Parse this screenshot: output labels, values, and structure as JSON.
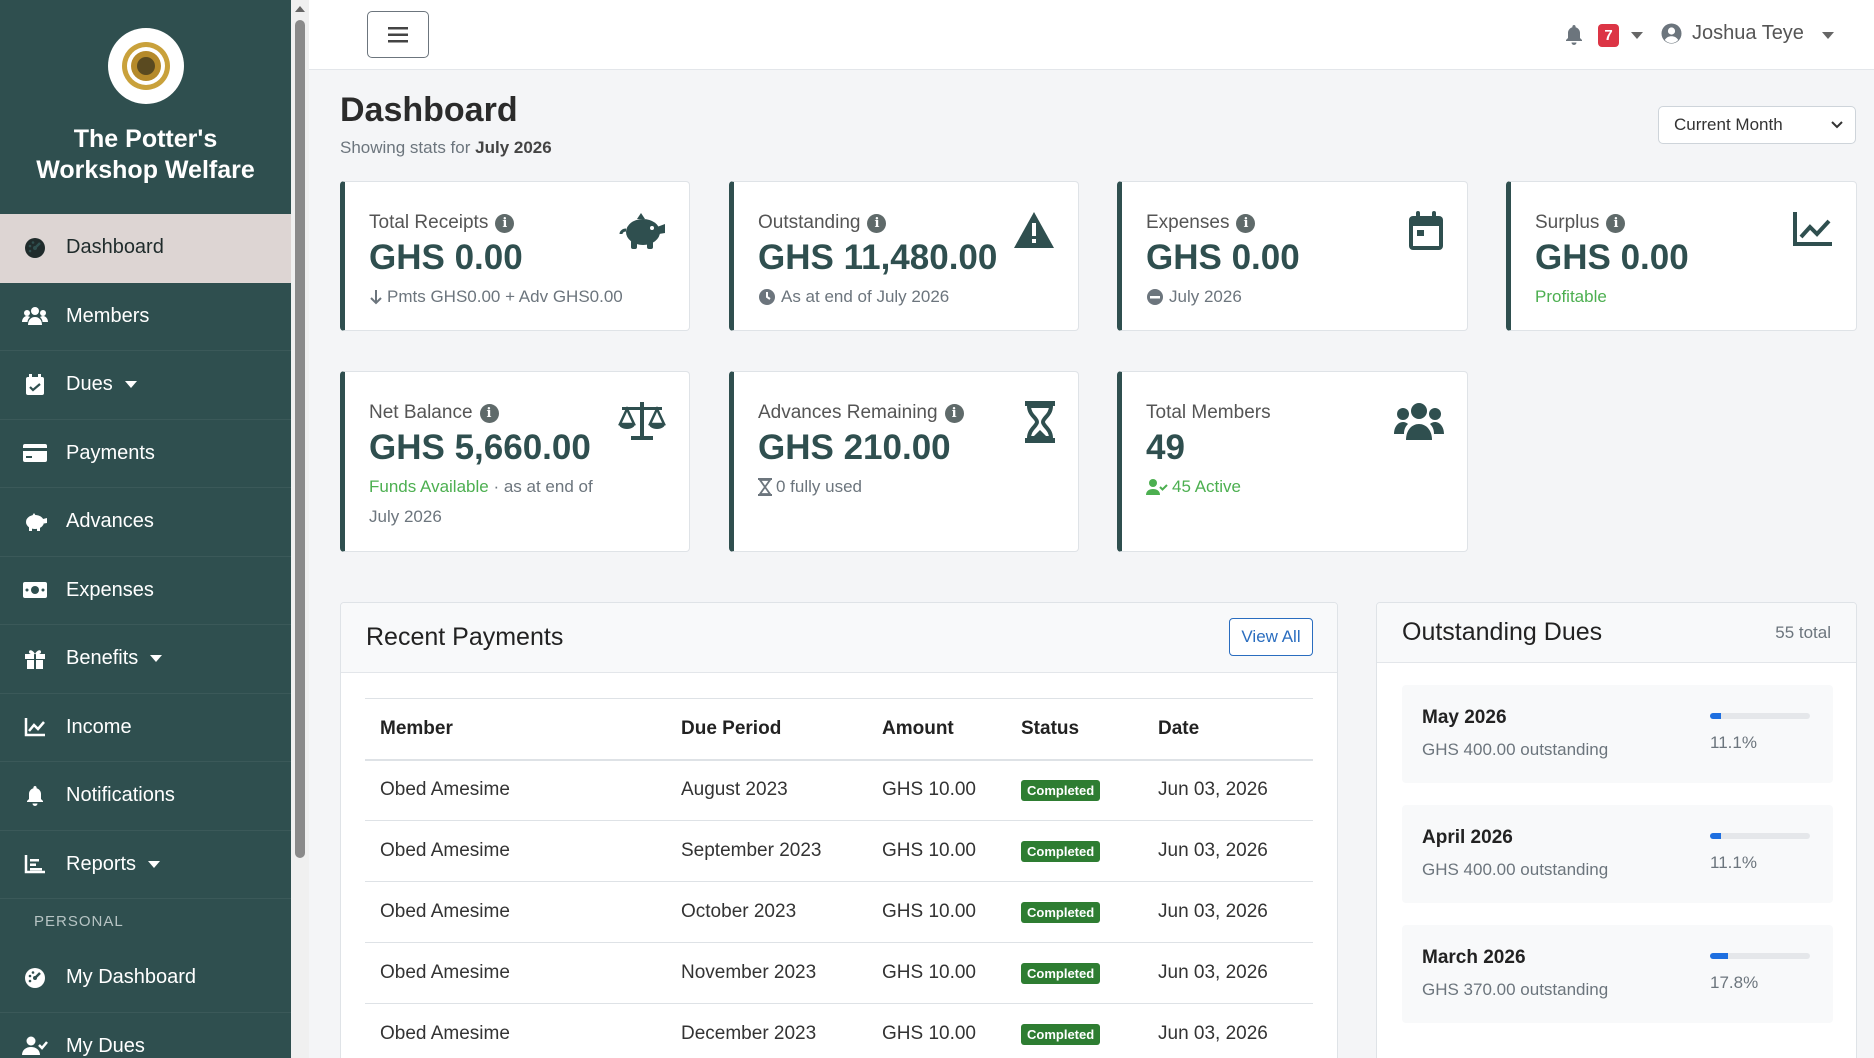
{
  "brand": {
    "name": "The Potter's Workshop Welfare"
  },
  "sidebar": {
    "items": [
      {
        "label": "Dashboard",
        "icon": "gauge-icon",
        "active": true,
        "caret": false
      },
      {
        "label": "Members",
        "icon": "users-icon",
        "active": false,
        "caret": false
      },
      {
        "label": "Dues",
        "icon": "calendar-check-icon",
        "active": false,
        "caret": true
      },
      {
        "label": "Payments",
        "icon": "credit-card-icon",
        "active": false,
        "caret": false
      },
      {
        "label": "Advances",
        "icon": "piggy-bank-icon",
        "active": false,
        "caret": false
      },
      {
        "label": "Expenses",
        "icon": "money-bill-icon",
        "active": false,
        "caret": false
      },
      {
        "label": "Benefits",
        "icon": "gift-icon",
        "active": false,
        "caret": true
      },
      {
        "label": "Income",
        "icon": "chart-line-icon",
        "active": false,
        "caret": false
      },
      {
        "label": "Notifications",
        "icon": "bell-icon",
        "active": false,
        "caret": false
      },
      {
        "label": "Reports",
        "icon": "chart-bar-icon",
        "active": false,
        "caret": true
      }
    ],
    "section_personal": "PERSONAL",
    "personal_items": [
      {
        "label": "My Dashboard",
        "icon": "gauge-icon"
      },
      {
        "label": "My Dues",
        "icon": "user-check-icon"
      }
    ]
  },
  "topbar": {
    "notification_count": "7",
    "user_name": "Joshua Teye"
  },
  "page": {
    "title": "Dashboard",
    "subtitle_prefix": "Showing stats for",
    "subtitle_period": "July 2026",
    "period_select": "Current Month"
  },
  "stats": {
    "total_receipts": {
      "label": "Total Receipts",
      "value": "GHS 0.00",
      "note": "Pmts GHS0.00 + Adv GHS0.00"
    },
    "outstanding": {
      "label": "Outstanding",
      "value": "GHS 11,480.00",
      "note": "As at end of July 2026"
    },
    "expenses": {
      "label": "Expenses",
      "value": "GHS 0.00",
      "note": "July 2026"
    },
    "surplus": {
      "label": "Surplus",
      "value": "GHS 0.00",
      "note": "Profitable"
    },
    "net_balance": {
      "label": "Net Balance",
      "value": "GHS 5,660.00",
      "note_green": "Funds Available",
      "note_rest": " · as at end of",
      "note_line2": "July 2026"
    },
    "advances_remaining": {
      "label": "Advances Remaining",
      "value": "GHS 210.00",
      "note": "0 fully used"
    },
    "total_members": {
      "label": "Total Members",
      "value": "49",
      "note": "45 Active"
    }
  },
  "recent_payments": {
    "title": "Recent Payments",
    "view_all": "View All",
    "columns": [
      "Member",
      "Due Period",
      "Amount",
      "Status",
      "Date"
    ],
    "rows": [
      [
        "Obed Amesime",
        "August 2023",
        "GHS 10.00",
        "Completed",
        "Jun 03, 2026"
      ],
      [
        "Obed Amesime",
        "September 2023",
        "GHS 10.00",
        "Completed",
        "Jun 03, 2026"
      ],
      [
        "Obed Amesime",
        "October 2023",
        "GHS 10.00",
        "Completed",
        "Jun 03, 2026"
      ],
      [
        "Obed Amesime",
        "November 2023",
        "GHS 10.00",
        "Completed",
        "Jun 03, 2026"
      ],
      [
        "Obed Amesime",
        "December 2023",
        "GHS 10.00",
        "Completed",
        "Jun 03, 2026"
      ]
    ]
  },
  "outstanding_dues": {
    "title": "Outstanding Dues",
    "total": "55 total",
    "items": [
      {
        "month": "May 2026",
        "amount": "GHS 400.00 outstanding",
        "percent_label": "11.1%",
        "percent": 11.1
      },
      {
        "month": "April 2026",
        "amount": "GHS 400.00 outstanding",
        "percent_label": "11.1%",
        "percent": 11.1
      },
      {
        "month": "March 2026",
        "amount": "GHS 370.00 outstanding",
        "percent_label": "17.8%",
        "percent": 17.8
      }
    ]
  },
  "colors": {
    "sidebar": "#2f4f4f",
    "active_item": "#ddd5d3",
    "accent": "#2f4f4f",
    "success": "#2e7d32",
    "progress": "#1e6fe0",
    "badge": "#dc3545"
  }
}
